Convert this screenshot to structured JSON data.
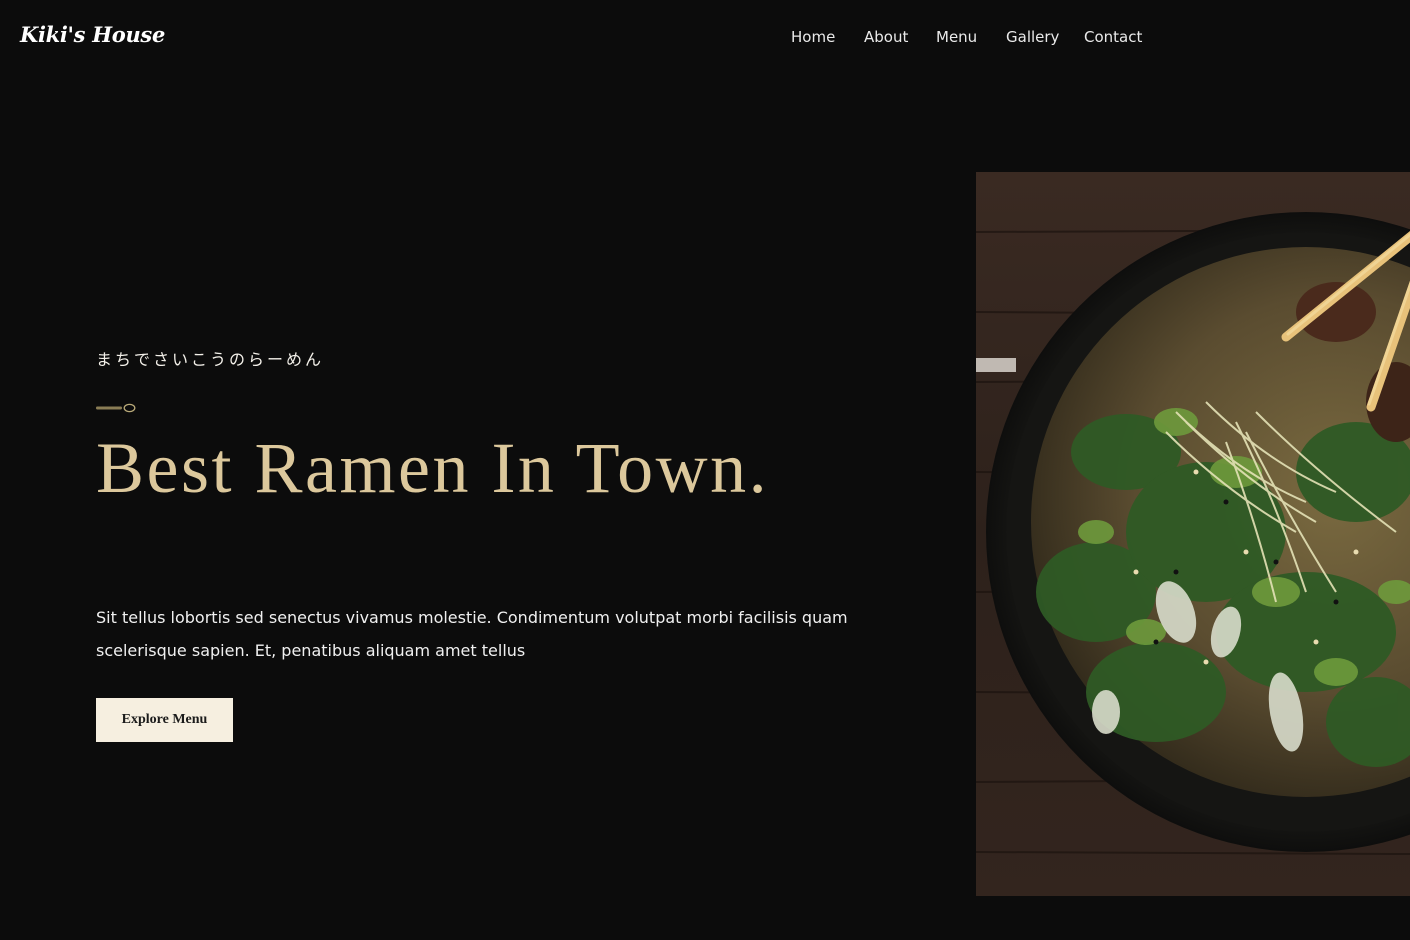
{
  "brand": {
    "name": "Kiki's House"
  },
  "nav": {
    "items": [
      {
        "label": "Home"
      },
      {
        "label": "About"
      },
      {
        "label": "Menu"
      },
      {
        "label": "Gallery"
      },
      {
        "label": "Contact"
      }
    ]
  },
  "hero": {
    "tagline": "まちでさいこうのらーめん",
    "headline": "Best Ramen In Town.",
    "description": "Sit tellus lobortis sed senectus vivamus molestie. Condimentum volutpat morbi facilisis quam scelerisque sapien. Et, penatibus aliquam amet tellus",
    "cta_label": "Explore Menu",
    "divider_icon": "spoon-icon",
    "image_subject": "ramen-bowl"
  },
  "colors": {
    "background": "#0c0c0c",
    "headline": "#dcc89c",
    "button_bg": "#f6efe0",
    "button_text": "#1b1b1b",
    "accent": "#8a7d55"
  }
}
